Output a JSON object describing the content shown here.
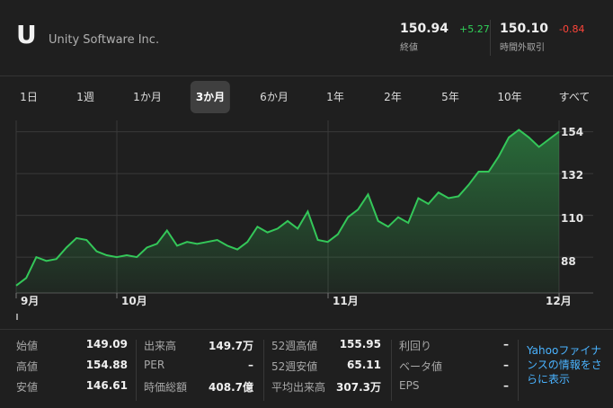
{
  "header": {
    "ticker": "U",
    "company": "Unity Software Inc.",
    "close_price": "150.94",
    "close_change": "+5.27",
    "close_label": "終値",
    "after_price": "150.10",
    "after_change": "-0.84",
    "after_label": "時間外取引"
  },
  "colors": {
    "up": "#30d158",
    "down": "#ff453a",
    "link": "#4ab3ff",
    "line": "#34c759"
  },
  "ranges": [
    {
      "label": "1日",
      "active": false
    },
    {
      "label": "1週",
      "active": false
    },
    {
      "label": "1か月",
      "active": false
    },
    {
      "label": "3か月",
      "active": true
    },
    {
      "label": "6か月",
      "active": false
    },
    {
      "label": "1年",
      "active": false
    },
    {
      "label": "2年",
      "active": false
    },
    {
      "label": "5年",
      "active": false
    },
    {
      "label": "10年",
      "active": false
    },
    {
      "label": "すべて",
      "active": false
    }
  ],
  "chart_data": {
    "type": "area",
    "y_ticks": [
      "154",
      "132",
      "110",
      "88"
    ],
    "y_tick_values": [
      154,
      132,
      110,
      88
    ],
    "x_tick_labels": [
      "9月",
      "10月",
      "11月",
      "12月"
    ],
    "ylim": [
      71,
      159
    ],
    "grid": true,
    "series": [
      {
        "values": [
          73,
          77,
          88,
          86,
          87,
          93,
          98,
          97,
          91,
          89,
          88,
          89,
          88,
          93,
          95,
          102,
          94,
          96,
          95,
          96,
          97,
          94,
          92,
          96,
          104,
          101,
          103,
          107,
          103,
          112,
          97,
          96,
          100,
          109,
          113,
          121,
          107,
          104,
          109,
          106,
          119,
          116,
          122,
          119,
          120,
          126,
          133,
          133,
          141,
          151,
          155,
          151,
          146,
          150,
          154
        ]
      }
    ]
  },
  "stats": {
    "col1": [
      {
        "label": "始値",
        "value": "149.09"
      },
      {
        "label": "高値",
        "value": "154.88"
      },
      {
        "label": "安値",
        "value": "146.61"
      }
    ],
    "col2": [
      {
        "label": "出来高",
        "value": "149.7万"
      },
      {
        "label": "PER",
        "value": "–"
      },
      {
        "label": "時価総額",
        "value": "408.7億"
      }
    ],
    "col3": [
      {
        "label": "52週高値",
        "value": "155.95"
      },
      {
        "label": "52週安値",
        "value": "65.11"
      },
      {
        "label": "平均出来高",
        "value": "307.3万"
      }
    ],
    "col4": [
      {
        "label": "利回り",
        "value": "–"
      },
      {
        "label": "ベータ値",
        "value": "–"
      },
      {
        "label": "EPS",
        "value": "–"
      }
    ],
    "yahoo_link": "Yahooファイナンスの情報をさらに表示"
  }
}
